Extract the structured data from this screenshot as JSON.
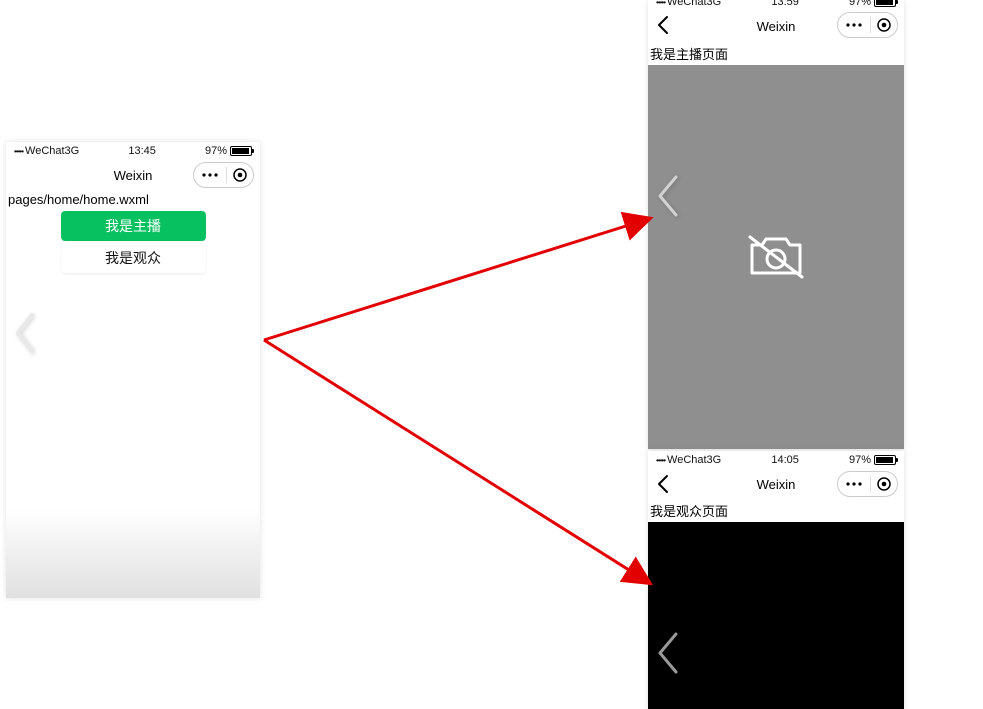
{
  "home": {
    "status": {
      "carrier": "WeChat3G",
      "time": "13:45",
      "battery_pct": "97%"
    },
    "nav": {
      "title": "Weixin"
    },
    "page_label": "pages/home/home.wxml",
    "buttons": {
      "anchor": "我是主播",
      "viewer": "我是观众"
    }
  },
  "anchor": {
    "status": {
      "carrier": "WeChat3G",
      "time": "13:59",
      "battery_pct": "97%"
    },
    "nav": {
      "title": "Weixin"
    },
    "page_label": "我是主播页面"
  },
  "viewer": {
    "status": {
      "carrier": "WeChat3G",
      "time": "14:05",
      "battery_pct": "97%"
    },
    "nav": {
      "title": "Weixin"
    },
    "page_label": "我是观众页面"
  }
}
